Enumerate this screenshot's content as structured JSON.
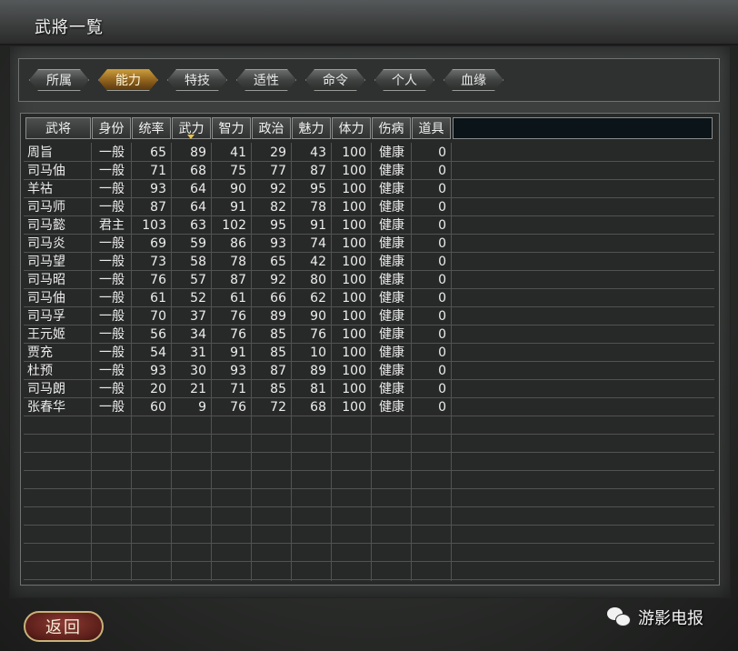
{
  "window_title": "武將一覧",
  "tabs": [
    {
      "label": "所属",
      "active": false
    },
    {
      "label": "能力",
      "active": true
    },
    {
      "label": "特技",
      "active": false
    },
    {
      "label": "适性",
      "active": false
    },
    {
      "label": "命令",
      "active": false
    },
    {
      "label": "个人",
      "active": false
    },
    {
      "label": "血缘",
      "active": false
    }
  ],
  "columns": [
    "武将",
    "身份",
    "统率",
    "武力",
    "智力",
    "政治",
    "魅力",
    "体力",
    "伤病",
    "道具"
  ],
  "sorted_column": "武力",
  "rows": [
    [
      "周旨",
      "一般",
      "65",
      "89",
      "41",
      "29",
      "43",
      "100",
      "健康",
      "0"
    ],
    [
      "司马伷",
      "一般",
      "71",
      "68",
      "75",
      "77",
      "87",
      "100",
      "健康",
      "0"
    ],
    [
      "羊祜",
      "一般",
      "93",
      "64",
      "90",
      "92",
      "95",
      "100",
      "健康",
      "0"
    ],
    [
      "司马师",
      "一般",
      "87",
      "64",
      "91",
      "82",
      "78",
      "100",
      "健康",
      "0"
    ],
    [
      "司马懿",
      "君主",
      "103",
      "63",
      "102",
      "95",
      "91",
      "100",
      "健康",
      "0"
    ],
    [
      "司马炎",
      "一般",
      "69",
      "59",
      "86",
      "93",
      "74",
      "100",
      "健康",
      "0"
    ],
    [
      "司马望",
      "一般",
      "73",
      "58",
      "78",
      "65",
      "42",
      "100",
      "健康",
      "0"
    ],
    [
      "司马昭",
      "一般",
      "76",
      "57",
      "87",
      "92",
      "80",
      "100",
      "健康",
      "0"
    ],
    [
      "司马伷",
      "一般",
      "61",
      "52",
      "61",
      "66",
      "62",
      "100",
      "健康",
      "0"
    ],
    [
      "司马孚",
      "一般",
      "70",
      "37",
      "76",
      "89",
      "90",
      "100",
      "健康",
      "0"
    ],
    [
      "王元姬",
      "一般",
      "56",
      "34",
      "76",
      "85",
      "76",
      "100",
      "健康",
      "0"
    ],
    [
      "贾充",
      "一般",
      "54",
      "31",
      "91",
      "85",
      "10",
      "100",
      "健康",
      "0"
    ],
    [
      "杜预",
      "一般",
      "93",
      "30",
      "93",
      "87",
      "89",
      "100",
      "健康",
      "0"
    ],
    [
      "司马朗",
      "一般",
      "20",
      "21",
      "71",
      "85",
      "81",
      "100",
      "健康",
      "0"
    ],
    [
      "张春华",
      "一般",
      "60",
      "9",
      "76",
      "72",
      "68",
      "100",
      "健康",
      "0"
    ]
  ],
  "back_button": "返回",
  "watermark": "游影电报",
  "colors": {
    "active_tab": "#c89a3a",
    "back_button": "#8c3a33"
  }
}
